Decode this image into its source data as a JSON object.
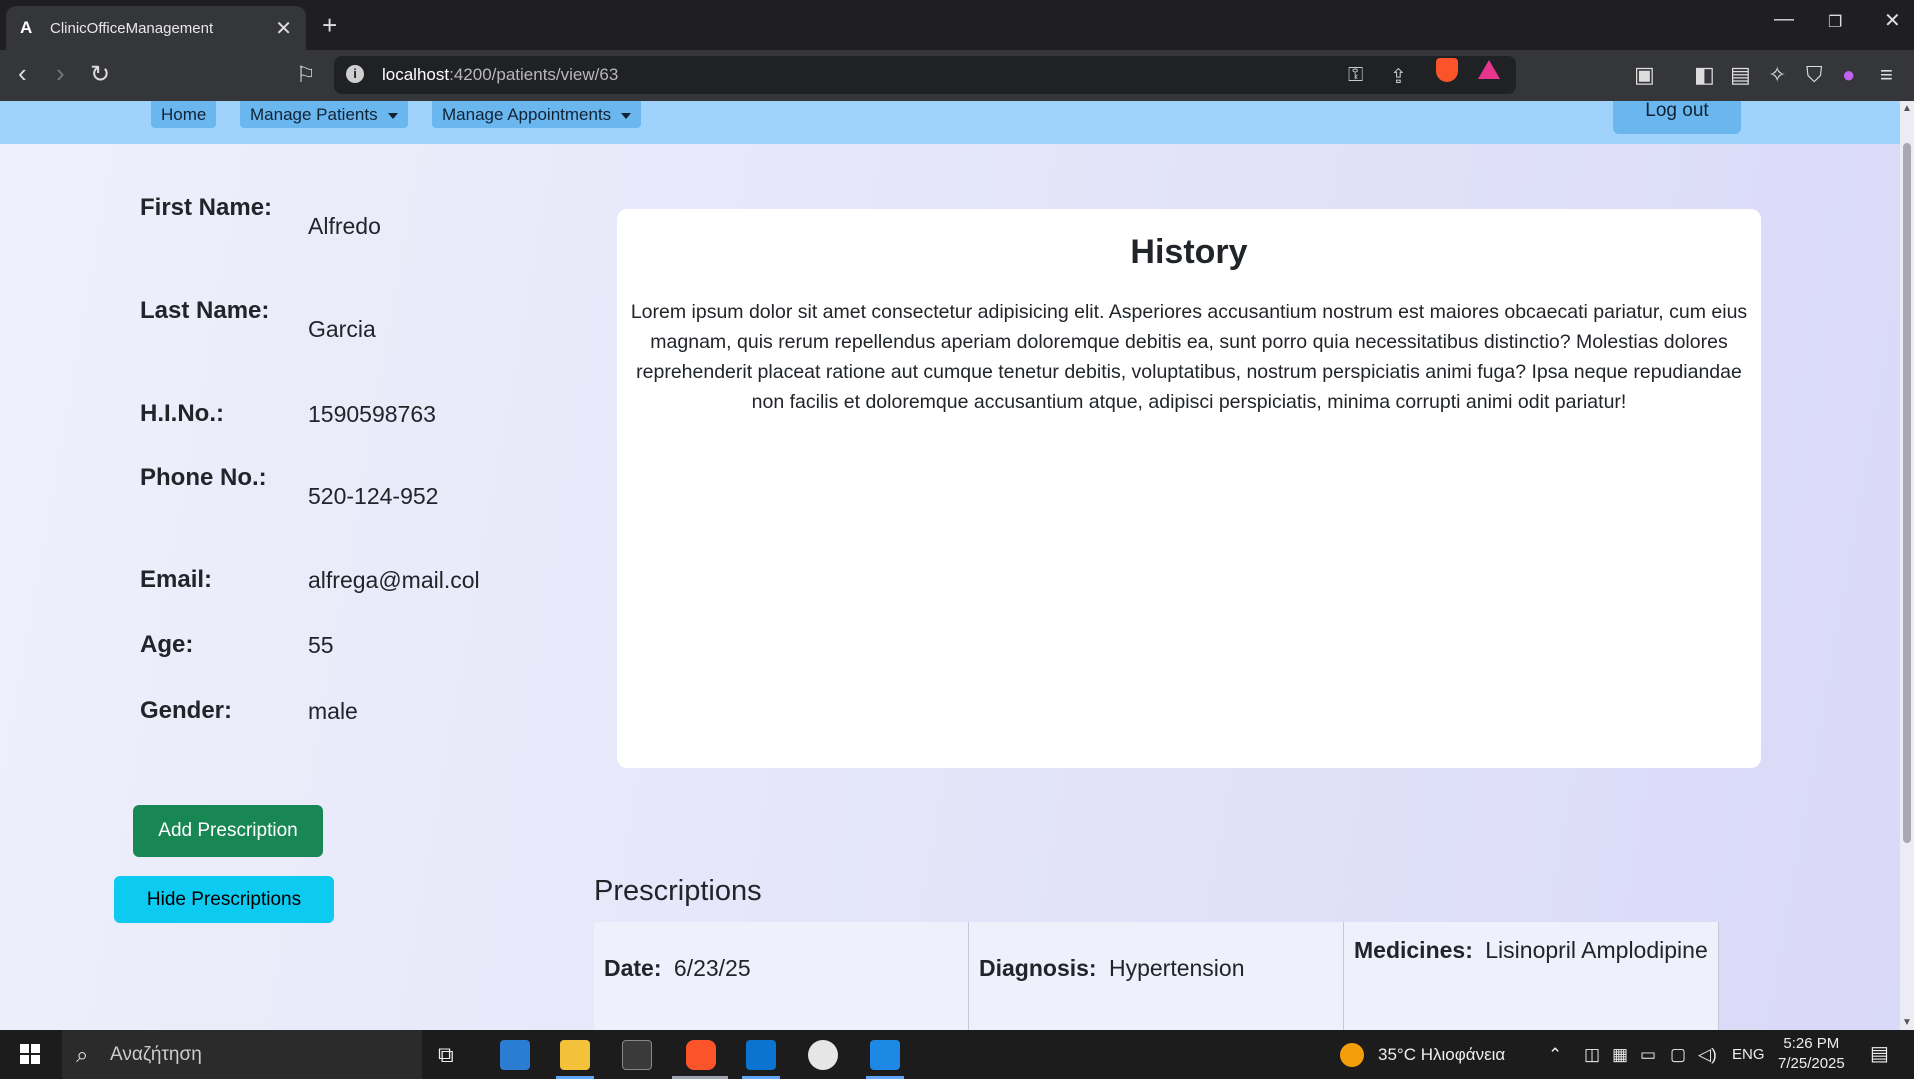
{
  "browser": {
    "tab_title": "ClinicOfficeManagement",
    "tab_icon": "A",
    "url_host": "localhost",
    "url_path": ":4200/patients/view/63"
  },
  "nav": {
    "home": "Home",
    "manage_patients": "Manage Patients",
    "manage_appointments": "Manage Appointments",
    "logout": "Log out"
  },
  "patient": {
    "first_name_label": "First Name:",
    "first_name": "Alfredo",
    "last_name_label": "Last Name:",
    "last_name": "Garcia",
    "hino_label": "H.I.No.:",
    "hino": "1590598763",
    "phone_label": "Phone No.:",
    "phone": "520-124-952",
    "email_label": "Email:",
    "email": "alfrega@mail.col",
    "age_label": "Age:",
    "age": "55",
    "gender_label": "Gender:",
    "gender": "male"
  },
  "history": {
    "title": "History",
    "text": "Lorem ipsum dolor sit amet consectetur adipisicing elit. Asperiores accusantium nostrum est maiores obcaecati pariatur, cum eius magnam, quis rerum repellendus aperiam doloremque debitis ea, sunt porro quia necessitatibus distinctio? Molestias dolores reprehenderit placeat ratione aut cumque tenetur debitis, voluptatibus, nostrum perspiciatis animi fuga? Ipsa neque repudiandae non facilis et doloremque accusantium atque, adipisci perspiciatis, minima corrupti animi odit pariatur!"
  },
  "actions": {
    "add_prescription": "Add Prescription",
    "hide_prescriptions": "Hide Prescriptions"
  },
  "prescriptions": {
    "title": "Prescriptions",
    "rows": [
      {
        "date_label": "Date:",
        "date": "6/23/25",
        "diagnosis_label": "Diagnosis:",
        "diagnosis": "Hypertension",
        "medicines_label": "Medicines:",
        "medicines": "Lisinopril Amplodipine"
      }
    ]
  },
  "taskbar": {
    "search_placeholder": "Αναζήτηση",
    "weather": "35°C  Ηλιοφάνεια",
    "language": "ENG",
    "time": "5:26 PM",
    "date": "7/25/2025"
  },
  "colors": {
    "navbar": "#9fd3fb",
    "nav_item": "#6ab7f0",
    "add_button": "#198754",
    "hide_button": "#0dcaf0"
  }
}
